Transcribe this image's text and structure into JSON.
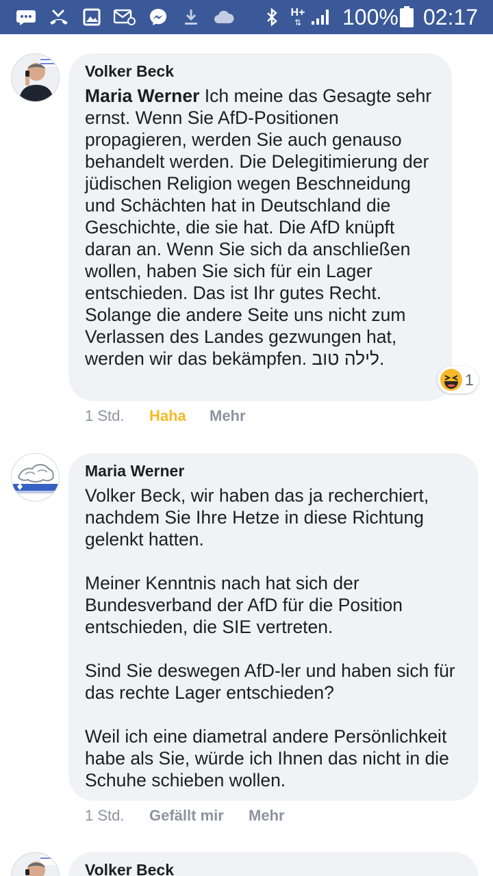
{
  "status_bar": {
    "battery": "100%",
    "time": "02:17",
    "network": "H+"
  },
  "comments": [
    {
      "author": "Volker Beck",
      "mention": "Maria Werner",
      "text": " Ich meine das Gesagte sehr ernst. Wenn Sie AfD-Positionen propagieren, werden Sie auch genauso behandelt werden. Die Delegitimierung der jüdischen Religion wegen Beschneidung und Schächten hat in Deutschland die Geschichte, die sie hat. Die AfD knüpft daran an. Wenn Sie sich da anschließen wollen, haben Sie sich für ein Lager entschieden. Das ist Ihr gutes Recht. Solange die andere Seite uns nicht zum Verlassen des Landes gezwungen hat, werden wir das bekämpfen. לילה טוב.",
      "time": "1 Std.",
      "reaction_label": "Haha",
      "more_label": "Mehr",
      "reaction_count": "1",
      "reaction_icon": "laughing-emoji-icon",
      "reaction_color": "#f7b928"
    },
    {
      "author": "Maria Werner",
      "paragraphs": [
        "Volker Beck, wir haben das ja recherchiert, nachdem Sie Ihre Hetze in diese Richtung gelenkt hatten.",
        "Meiner Kenntnis nach hat sich der Bundesverband der AfD für die Position entschieden, die SIE vertreten.",
        "Sind Sie deswegen AfD-ler und haben sich für das rechte Lager entschieden?",
        "Weil ich eine diametral andere Persönlichkeit habe als Sie, würde ich Ihnen das nicht in die Schuhe schieben wollen."
      ],
      "time": "1 Std.",
      "like_label": "Gefällt mir",
      "more_label": "Mehr"
    },
    {
      "author": "Volker Beck"
    }
  ],
  "colors": {
    "status_bar": "#3b5998",
    "bubble": "#f0f2f5",
    "meta_text": "#8d949e",
    "haha": "#f7b928"
  }
}
